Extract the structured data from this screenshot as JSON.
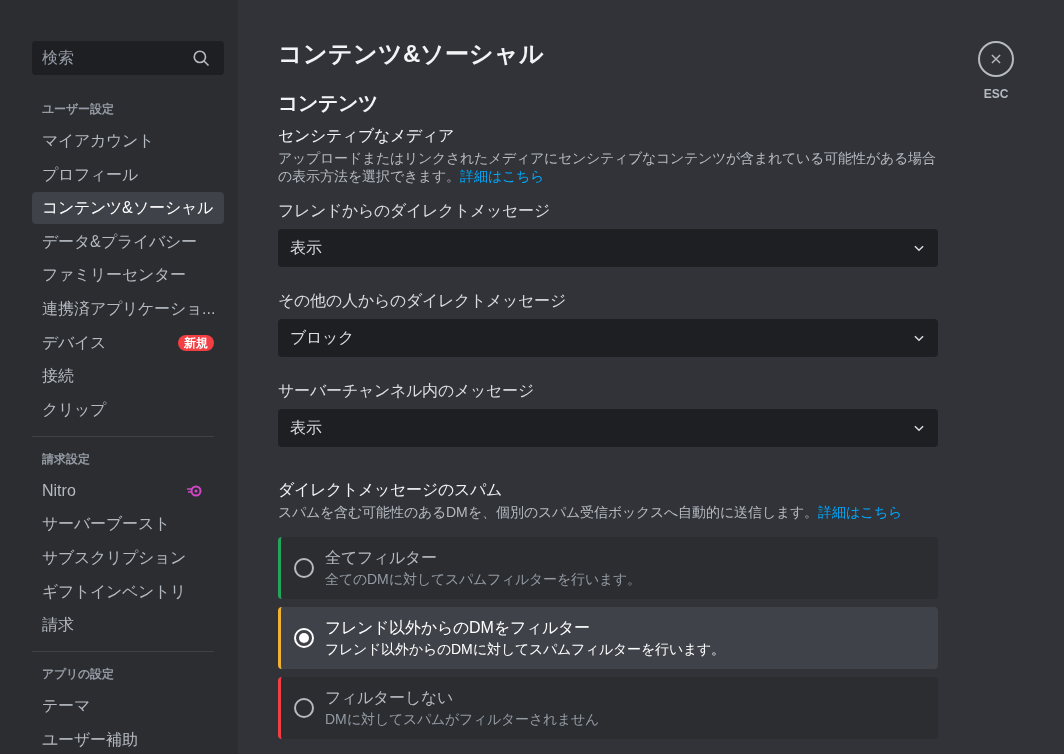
{
  "search": {
    "placeholder": "検索"
  },
  "sidebar": {
    "groups": [
      {
        "heading": "ユーザー設定",
        "items": [
          {
            "label": "マイアカウント",
            "selected": false,
            "kind": "plain"
          },
          {
            "label": "プロフィール",
            "selected": false,
            "kind": "plain"
          },
          {
            "label": "コンテンツ&ソーシャル",
            "selected": true,
            "kind": "plain"
          },
          {
            "label": "データ&プライバシー",
            "selected": false,
            "kind": "plain"
          },
          {
            "label": "ファミリーセンター",
            "selected": false,
            "kind": "plain"
          },
          {
            "label": "連携済アプリケーショ...",
            "selected": false,
            "kind": "plain"
          },
          {
            "label": "デバイス",
            "selected": false,
            "kind": "badge",
            "badge": "新規"
          },
          {
            "label": "接続",
            "selected": false,
            "kind": "plain"
          },
          {
            "label": "クリップ",
            "selected": false,
            "kind": "plain"
          }
        ]
      },
      {
        "heading": "請求設定",
        "items": [
          {
            "label": "Nitro",
            "selected": false,
            "kind": "nitro"
          },
          {
            "label": "サーバーブースト",
            "selected": false,
            "kind": "plain"
          },
          {
            "label": "サブスクリプション",
            "selected": false,
            "kind": "plain"
          },
          {
            "label": "ギフトインベントリ",
            "selected": false,
            "kind": "plain"
          },
          {
            "label": "請求",
            "selected": false,
            "kind": "plain"
          }
        ]
      },
      {
        "heading": "アプリの設定",
        "items": [
          {
            "label": "テーマ",
            "selected": false,
            "kind": "plain"
          },
          {
            "label": "ユーザー補助",
            "selected": false,
            "kind": "plain"
          }
        ]
      }
    ]
  },
  "title": "コンテンツ&ソーシャル",
  "close": {
    "label": "ESC"
  },
  "section_heading": "コンテンツ",
  "sensitive_media": {
    "title": "センシティブなメディア",
    "description": "アップロードまたはリンクされたメディアにセンシティブなコンテンツが含まれている可能性がある場合の表示方法を選択できます。",
    "link": "詳細はこちら"
  },
  "selects": [
    {
      "label": "フレンドからのダイレクトメッセージ",
      "value": "表示"
    },
    {
      "label": "その他の人からのダイレクトメッセージ",
      "value": "ブロック"
    },
    {
      "label": "サーバーチャンネル内のメッセージ",
      "value": "表示"
    }
  ],
  "spam": {
    "title": "ダイレクトメッセージのスパム",
    "description": "スパムを含む可能性のあるDMを、個別のスパム受信ボックスへ自動的に送信します。",
    "link": "詳細はこちら",
    "options": [
      {
        "title": "全てフィルター",
        "description": "全てのDMに対してスパムフィルターを行います。",
        "selected": false,
        "color": "#23a55a"
      },
      {
        "title": "フレンド以外からのDMをフィルター",
        "description": "フレンド以外からのDMに対してスパムフィルターを行います。",
        "selected": true,
        "color": "#f0b232"
      },
      {
        "title": "フィルターしない",
        "description": "DMに対してスパムがフィルターされません",
        "selected": false,
        "color": "#f23f43"
      }
    ]
  }
}
